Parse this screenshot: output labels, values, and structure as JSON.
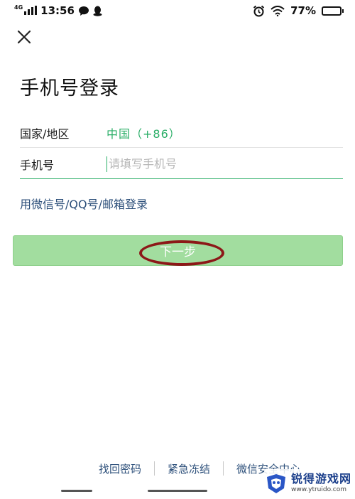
{
  "status_bar": {
    "network": "4G",
    "time": "13:56",
    "battery_percent": "77%",
    "battery_level": 0.77,
    "icons_left": [
      "signal-icon",
      "chat-bubble-icon",
      "penguin-icon"
    ],
    "icons_right": [
      "alarm-icon",
      "wifi-icon",
      "battery-icon"
    ]
  },
  "header": {
    "close_icon": "close-icon",
    "title": "手机号登录"
  },
  "form": {
    "country_label": "国家/地区",
    "country_value": "中国（+86）",
    "phone_label": "手机号",
    "phone_placeholder": "请填写手机号",
    "phone_value": ""
  },
  "alt_login": "用微信号/QQ号/邮箱登录",
  "next_button": "下一步",
  "footer": {
    "links": [
      "找回密码",
      "紧急冻结",
      "微信安全中心"
    ]
  },
  "watermark": {
    "title": "锐得游戏网",
    "url": "www.ytruido.com"
  },
  "colors": {
    "accent_green": "#2aae67",
    "button_disabled": "#a2dd9f",
    "link_blue": "#2c4f7a",
    "annotation_red": "#8c1818"
  }
}
